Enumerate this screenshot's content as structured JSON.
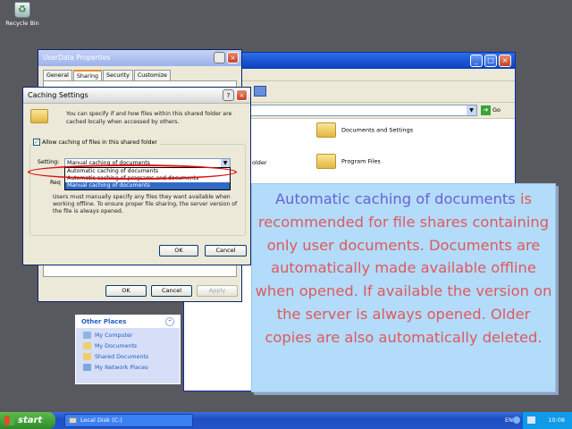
{
  "desktop": {
    "recycle_bin_label": "Recycle Bin"
  },
  "explorer": {
    "go_label": "Go",
    "items": [
      {
        "label": "Documents and Settings"
      },
      {
        "label": "older"
      },
      {
        "label": "Program Files"
      }
    ],
    "other_places": {
      "title": "Other Places",
      "items": [
        "My Computer",
        "My Documents",
        "Shared Documents",
        "My Network Places"
      ]
    }
  },
  "properties_dialog": {
    "title": "UserData Properties",
    "tabs": [
      "General",
      "Sharing",
      "Security",
      "Customize"
    ],
    "ok_label": "OK",
    "cancel_label": "Cancel",
    "apply_label": "Apply"
  },
  "caching_dialog": {
    "title": "Caching Settings",
    "description": "You can specify if and how files within this shared folder are cached locally when accessed by others.",
    "allow_label": "Allow caching of files in this shared folder",
    "setting_label": "Setting:",
    "selected_value": "Manual caching of documents",
    "options": [
      "Automatic caching of documents",
      "Automatic caching of programs and documents",
      "Manual caching of documents"
    ],
    "req_text": "Req",
    "note": "Users must manually specify any files they want available when working offline. To ensure proper file sharing, the server version of the file is always opened.",
    "ok_label": "OK",
    "cancel_label": "Cancel"
  },
  "callout": {
    "highlight": "Automatic caching of documents",
    "text": " is recommended for file shares containing only user documents. Documents are automatically made available offline when opened. If available the version on the server is always opened. Older copies are also automatically deleted."
  },
  "taskbar": {
    "start_label": "start",
    "task_label": "Local Disk (C:)",
    "language": "EN",
    "clock": "10:08"
  },
  "colors": {
    "callout_bg": "#b2dcfa",
    "callout_text": "#e0585e",
    "callout_highlight": "#6a61d6",
    "annotation_oval": "#e01010"
  }
}
